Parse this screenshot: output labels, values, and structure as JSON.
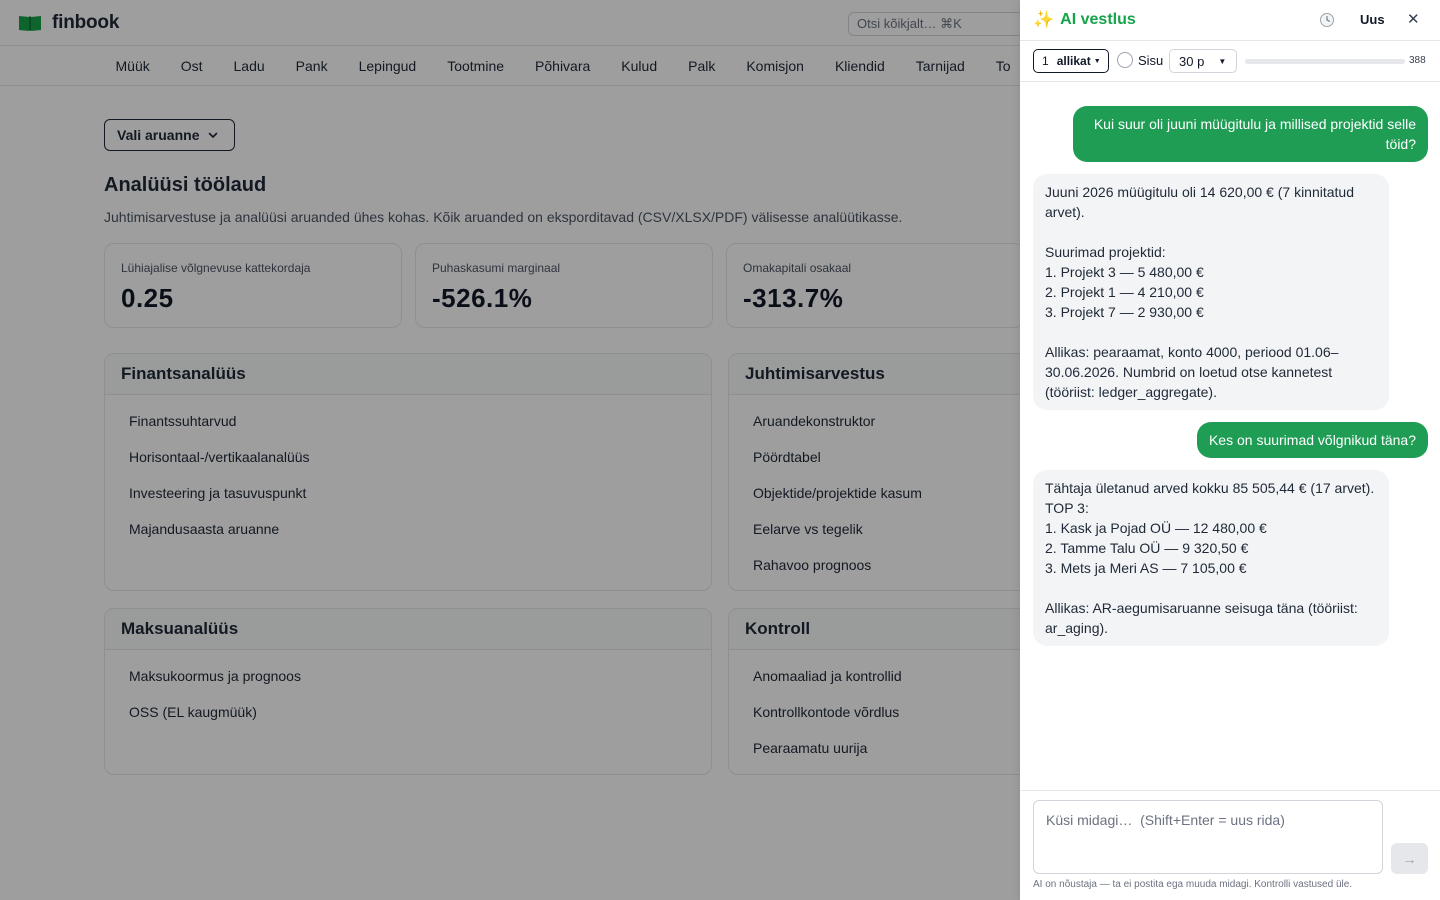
{
  "app": {
    "logo_text": "finbook",
    "search_placeholder": "Otsi kõikjalt…  ⌘K"
  },
  "nav": [
    "Müük",
    "Ost",
    "Ladu",
    "Pank",
    "Lepingud",
    "Tootmine",
    "Põhivara",
    "Kulud",
    "Palk",
    "Komisjon",
    "Kliendid",
    "Tarnijad",
    "To"
  ],
  "page": {
    "report_select_label": "Vali aruanne",
    "title": "Analüüsi töölaud",
    "subtitle": "Juhtimisarvestuse ja analüüsi aruanded ühes kohas. Kõik aruanded on eksporditavad (CSV/XLSX/PDF) välisesse analüütikasse."
  },
  "kpis": [
    {
      "label": "Lühiajalise võlgnevuse kattekordaja",
      "value": "0.25"
    },
    {
      "label": "Puhaskasumi marginaal",
      "value": "-526.1%"
    },
    {
      "label": "Omakapitali osakaal",
      "value": "-313.7%"
    }
  ],
  "cards": {
    "finance": {
      "title": "Finantsanalüüs",
      "items": [
        "Finantssuhtarvud",
        "Horisontaal-/vertikaalanalüüs",
        "Investeering ja tasuvuspunkt",
        "Majandusaasta aruanne"
      ]
    },
    "management": {
      "title": "Juhtimisarvestus",
      "items": [
        "Aruandekonstruktor",
        "Pöördtabel",
        "Objektide/projektide kasum",
        "Eelarve vs tegelik",
        "Rahavoo prognoos"
      ]
    },
    "payments": {
      "title": "Maksuanalüüs",
      "items": [
        "Maksukoormus ja prognoos",
        "OSS (EL kaugmüük)"
      ]
    },
    "control": {
      "title": "Kontroll",
      "items": [
        "Anomaaliad ja kontrollid",
        "Kontrollkontode võrdlus",
        "Pearaamatu uurija"
      ]
    }
  },
  "panel": {
    "title": "AI vestlus",
    "new_label": "Uus",
    "sources_count": "1",
    "sources_label": "allikat",
    "sisu_label": "Sisu",
    "range_label": "30 p",
    "usage_count": "388",
    "usage_fraction": 0.0,
    "input_placeholder": "Küsi midagi…  (Shift+Enter = uus rida)",
    "disclaimer": "AI on nõustaja — ta ei postita ega muuda midagi. Kontrolli vastused üle."
  },
  "messages": [
    {
      "role": "user",
      "text": "Kui suur oli juuni müügitulu ja millised projektid selle töid?"
    },
    {
      "role": "assistant",
      "text": "Juuni 2026 müügitulu oli 14 620,00 € (7 kinnitatud arvet).\n\nSuurimad projektid:\n1. Projekt 3 — 5 480,00 €\n2. Projekt 1 — 4 210,00 €\n3. Projekt 7 — 2 930,00 €\n\nAllikas: pearaamat, konto 4000, periood 01.06–30.06.2026. Numbrid on loetud otse kannetest (tööriist: ledger_aggregate)."
    },
    {
      "role": "user",
      "text": "Kes on suurimad võlgnikud täna?"
    },
    {
      "role": "assistant",
      "text": "Tähtaja ületanud arved kokku 85 505,44 € (17 arvet). TOP 3:\n1. Kask ja Pojad OÜ — 12 480,00 €\n2. Tamme Talu OÜ — 9 320,50 €\n3. Mets ja Meri AS — 7 105,00 €\n\nAllikas: AR-aegumisaruanne seisuga täna (tööriist: ar_aging)."
    }
  ]
}
